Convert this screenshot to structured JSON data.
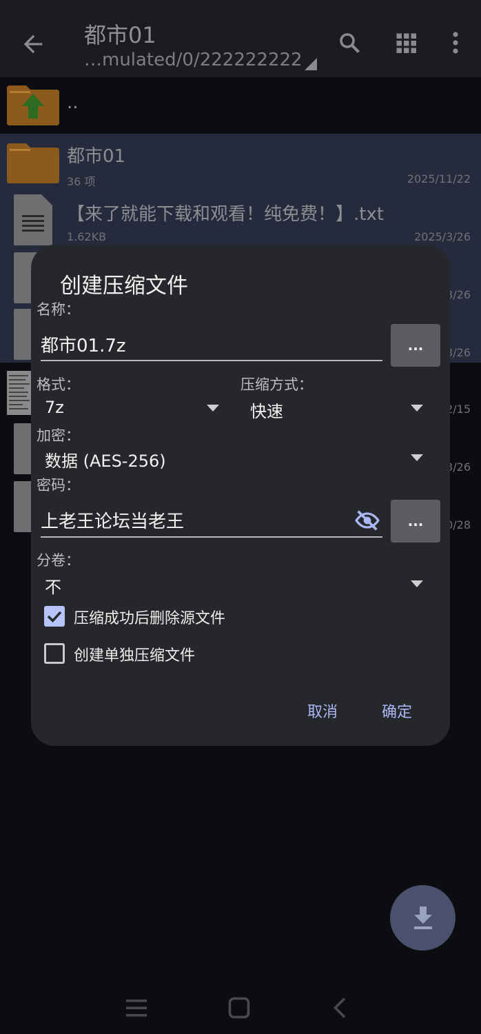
{
  "topbar": {
    "title": "都市01",
    "path": "…mulated/0/222222222",
    "icons": [
      "back-arrow-icon",
      "search-icon",
      "grid-view-icon",
      "more-vert-icon"
    ]
  },
  "list": {
    "parent_label": "..",
    "items": [
      {
        "name": "都市01",
        "meta": "36 项",
        "date": "2025/11/22",
        "type": "folder"
      },
      {
        "name": "【来了就能下载和观看！纯免费！】.txt",
        "meta": "1.62KB",
        "date": "2025/3/26",
        "type": "file"
      },
      {
        "date": "3/26"
      },
      {
        "date": "3/26"
      },
      {
        "date": "2/15"
      },
      {
        "date": "3/26"
      },
      {
        "date": "0/28"
      }
    ]
  },
  "dialog": {
    "title": "创建压缩文件",
    "name_label": "名称：",
    "name_value": "都市01.7z",
    "browse_label": "...",
    "format_label": "格式：",
    "format_value": "7z",
    "method_label": "压缩方式：",
    "method_value": "快速",
    "encrypt_label": "加密：",
    "encrypt_value": "数据 (AES-256)",
    "password_label": "密码：",
    "password_value": "上老王论坛当老王",
    "password_more": "...",
    "split_label": "分卷：",
    "split_value": "不",
    "delete_source_label": "压缩成功后删除源文件",
    "delete_source_checked": true,
    "separate_label": "创建单独压缩文件",
    "separate_checked": false,
    "cancel_label": "取消",
    "ok_label": "确定"
  },
  "colors": {
    "accent": "#a9b8f5",
    "dialog_bg": "#26272b",
    "selected_row": "#252a3c",
    "folder": "#8b5a1c"
  }
}
